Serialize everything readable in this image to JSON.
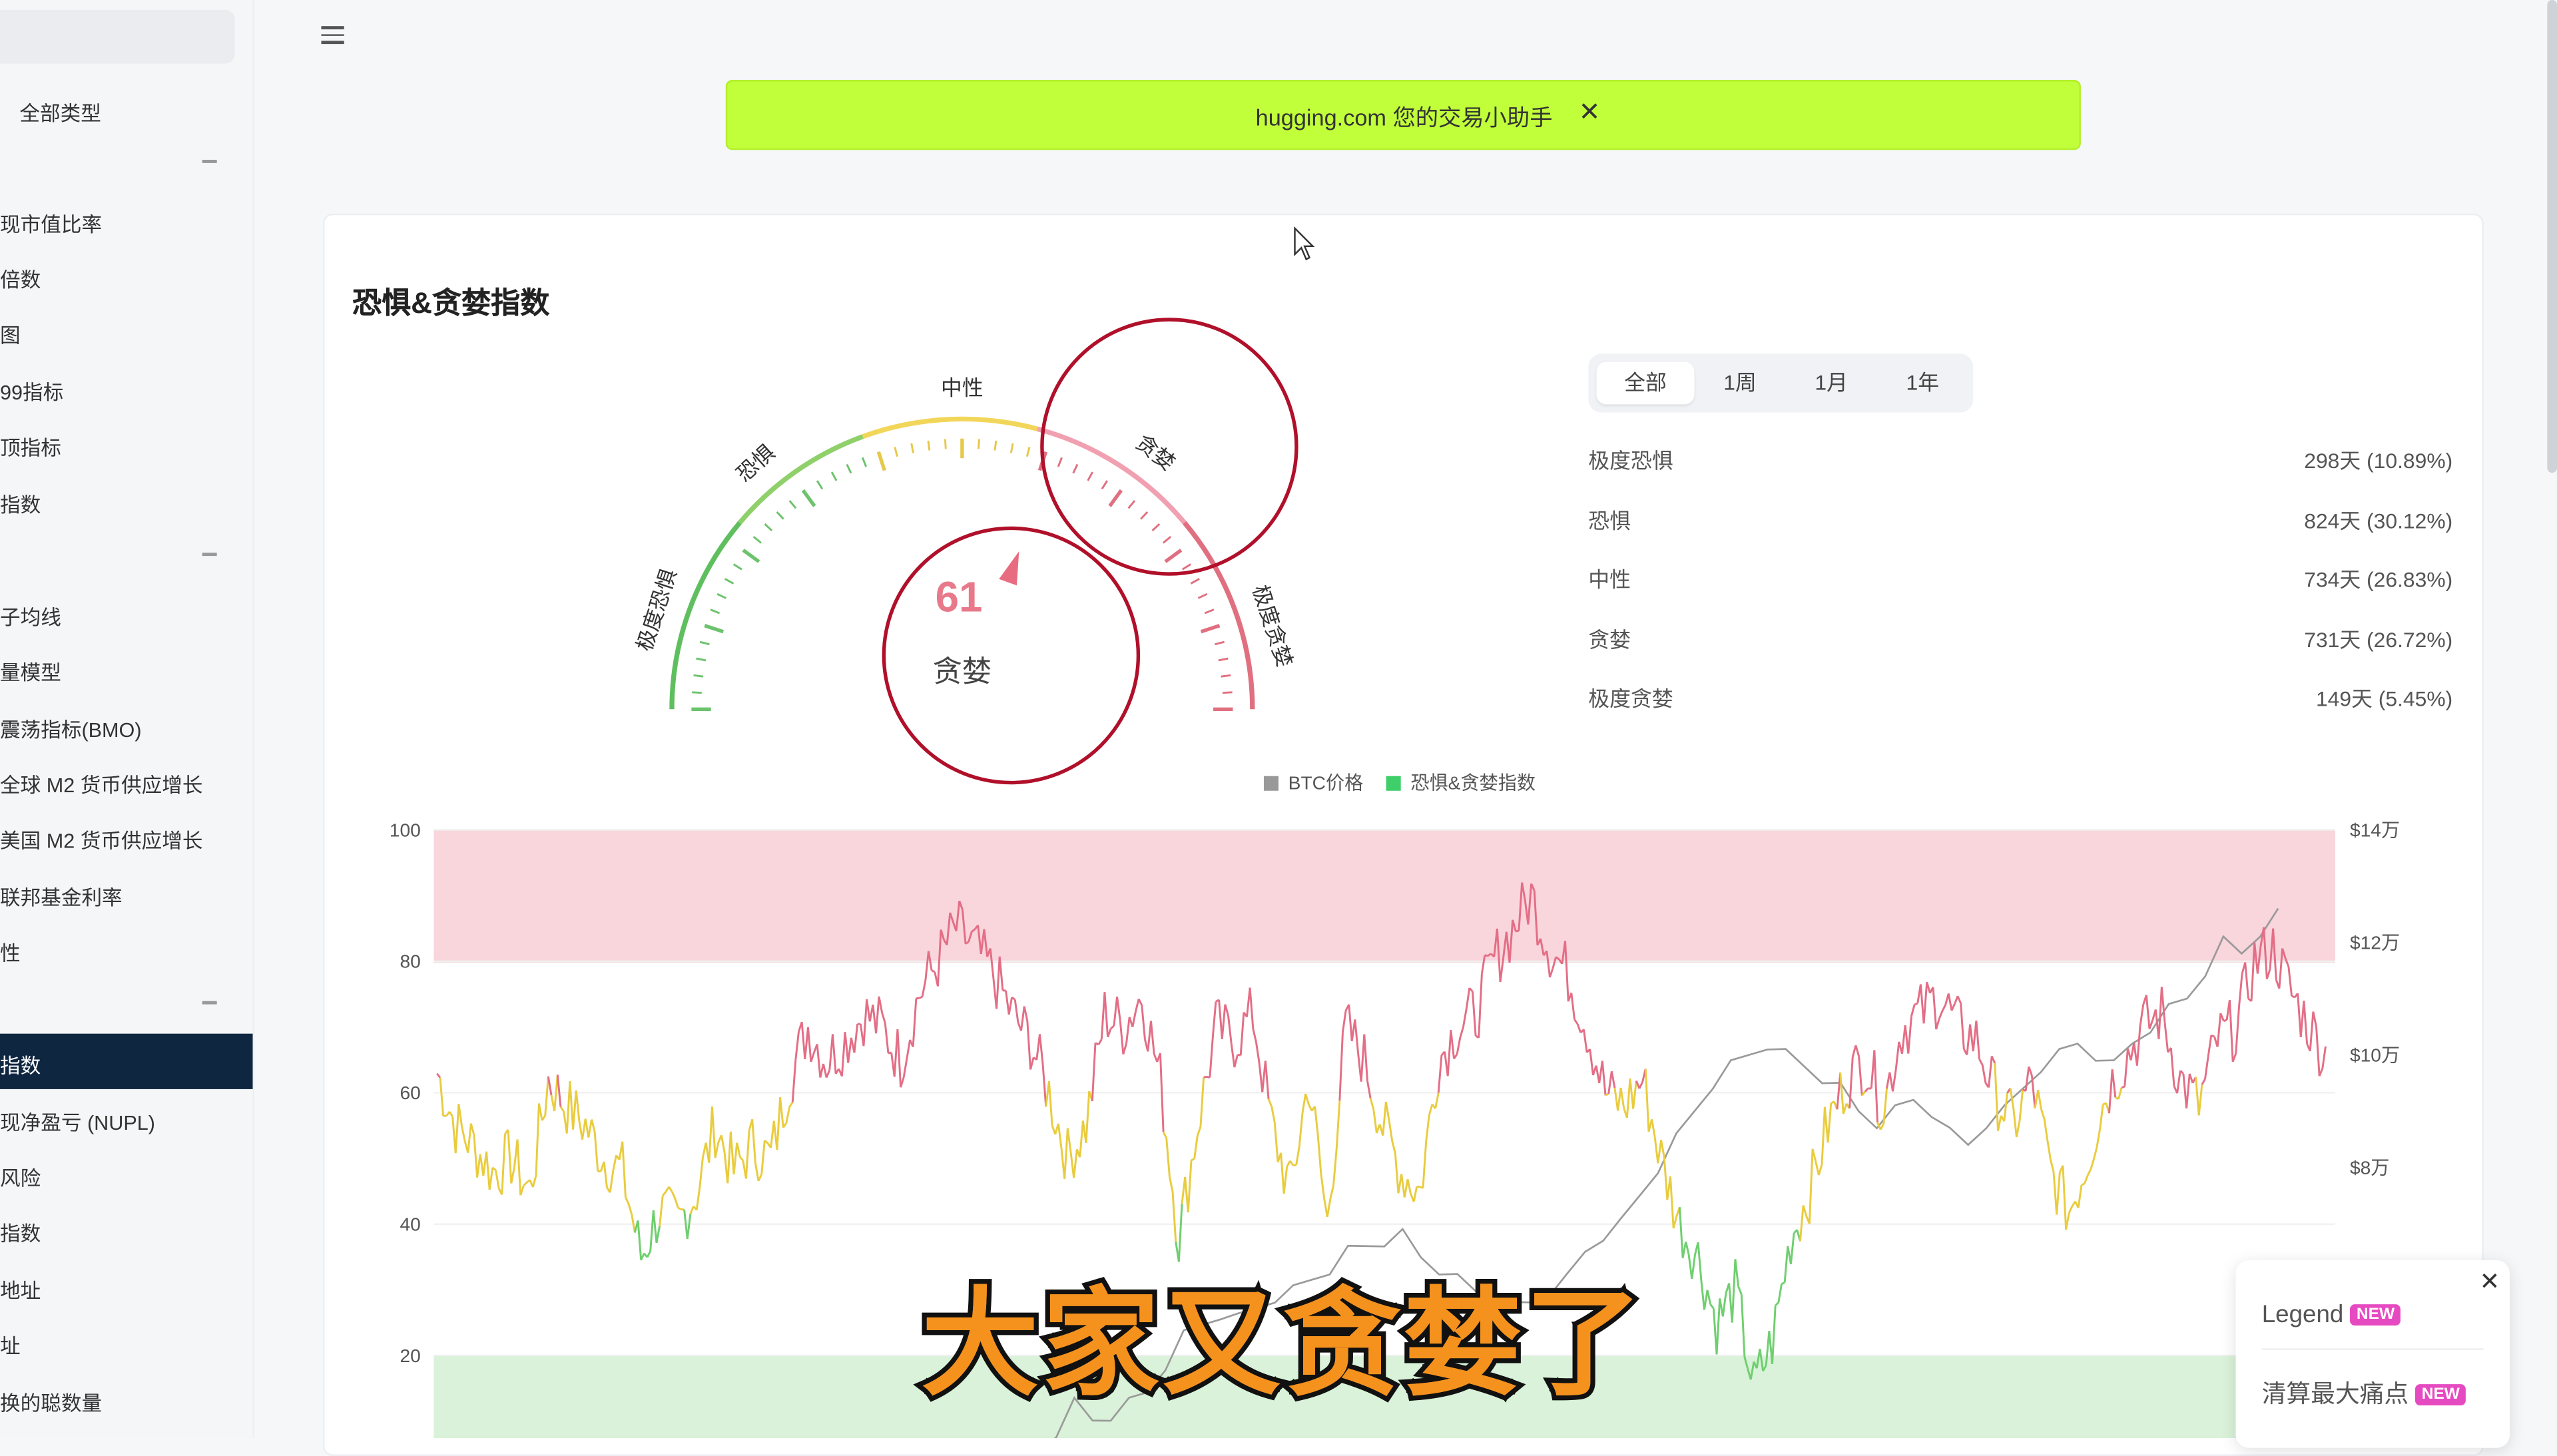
{
  "banner": {
    "text": "hugging.com 您的交易小助手",
    "close": "✕"
  },
  "sidebar": {
    "items": [
      {
        "label": "全部类型",
        "y": 59
      },
      {
        "label": "现市值比率",
        "y": 127
      },
      {
        "label": "倍数",
        "y": 161
      },
      {
        "label": "图",
        "y": 195
      },
      {
        "label": "99指标",
        "y": 230
      },
      {
        "label": "顶指标",
        "y": 264
      },
      {
        "label": "指数",
        "y": 299
      },
      {
        "label": "子均线",
        "y": 368
      },
      {
        "label": "量模型",
        "y": 402
      },
      {
        "label": "震荡指标(BMO)",
        "y": 437
      },
      {
        "label": "全球 M2 货币供应增长",
        "y": 471
      },
      {
        "label": "美国 M2 货币供应增长",
        "y": 505
      },
      {
        "label": "联邦基金利率",
        "y": 540
      },
      {
        "label": "性",
        "y": 574
      },
      {
        "label": "现净盈亏 (NUPL)",
        "y": 678
      },
      {
        "label": "风险",
        "y": 712
      },
      {
        "label": "指数",
        "y": 746
      },
      {
        "label": "地址",
        "y": 781
      },
      {
        "label": "址",
        "y": 815
      },
      {
        "label": "换的聪数量",
        "y": 850
      }
    ],
    "active": "指数"
  },
  "card": {
    "title": "恐惧&贪婪指数"
  },
  "gauge": {
    "value": "61",
    "label": "贪婪",
    "zones": [
      "极度恐惧",
      "恐惧",
      "中性",
      "贪婪",
      "极度贪婪"
    ]
  },
  "tabs": [
    "全部",
    "1周",
    "1月",
    "1年"
  ],
  "stats": [
    {
      "label": "极度恐惧",
      "value": "298天 (10.89%)"
    },
    {
      "label": "恐惧",
      "value": "824天 (30.12%)"
    },
    {
      "label": "中性",
      "value": "734天 (26.83%)"
    },
    {
      "label": "贪婪",
      "value": "731天 (26.72%)"
    },
    {
      "label": "极度贪婪",
      "value": "149天 (5.45%)"
    }
  ],
  "chart_data": {
    "type": "line",
    "legend": [
      "BTC价格",
      "恐惧&贪婪指数"
    ],
    "left_axis_ticks": [
      "100",
      "80",
      "60",
      "40",
      "20"
    ],
    "right_axis_ticks": [
      "$14万",
      "$12万",
      "$10万",
      "$8万"
    ],
    "ylim": [
      0,
      100
    ],
    "series": [
      {
        "name": "恐惧&贪婪指数",
        "values": [
          63,
          55,
          52,
          48,
          50,
          45,
          62,
          58,
          55,
          50,
          48,
          35,
          42,
          40,
          45,
          55,
          48,
          52,
          50,
          62,
          70,
          65,
          68,
          72,
          70,
          65,
          75,
          80,
          85,
          82,
          78,
          72,
          68,
          60,
          50,
          55,
          72,
          70,
          75,
          62,
          38,
          55,
          70,
          68,
          72,
          55,
          45,
          62,
          40,
          70,
          65,
          55,
          48,
          45,
          65,
          70,
          72,
          80,
          85,
          90,
          82,
          78,
          70,
          60,
          58,
          62,
          50,
          40,
          35,
          25,
          30,
          15,
          22,
          38,
          45,
          55,
          62,
          65,
          58,
          70,
          72,
          75,
          70,
          68,
          60,
          55,
          62,
          48,
          42,
          50,
          60,
          65,
          70,
          72,
          62,
          58,
          68,
          70,
          80,
          82,
          75,
          70,
          65
        ]
      },
      {
        "name": "BTC价格",
        "values": [
          0.5,
          0.6,
          0.6,
          0.7,
          0.8,
          0.9,
          1.0,
          1.2,
          1.5,
          1.8,
          2.0,
          2.2,
          2.5,
          3.0,
          3.3,
          3.8,
          3.5,
          3.6,
          3.8,
          4.0,
          4.5,
          5.0,
          5.2,
          5.4,
          5.3,
          5.5,
          5.7,
          5.8,
          6.0,
          6.2,
          6.5,
          6.6,
          6.7,
          6.8,
          6.4,
          6.2,
          6.0,
          5.8,
          5.6,
          5.5,
          5.6,
          5.8,
          6.0,
          6.5,
          6.8,
          7.0,
          7.5,
          8.0,
          8.5,
          9.0,
          9.5,
          9.8,
          10.0,
          10.2,
          10.0,
          9.8,
          9.6,
          9.4,
          9.0,
          8.8,
          9.0,
          9.2,
          9.0,
          8.6,
          8.4,
          8.8,
          9.0,
          9.4,
          9.8,
          10.0,
          10.2,
          10.0,
          9.8,
          10.2,
          10.5,
          10.8,
          11.0,
          11.5,
          12.0,
          11.8,
          12.2,
          12.5
        ]
      }
    ],
    "bands": [
      {
        "from": 80,
        "to": 100,
        "color": "#f9d5dc"
      },
      {
        "from": 0,
        "to": 20,
        "color": "#d9f2d9"
      }
    ]
  },
  "legend_panel": {
    "close": "✕",
    "row1": "Legend",
    "row2": "清算最大痛点",
    "badge": "NEW"
  },
  "caption": "大家又贪婪了"
}
